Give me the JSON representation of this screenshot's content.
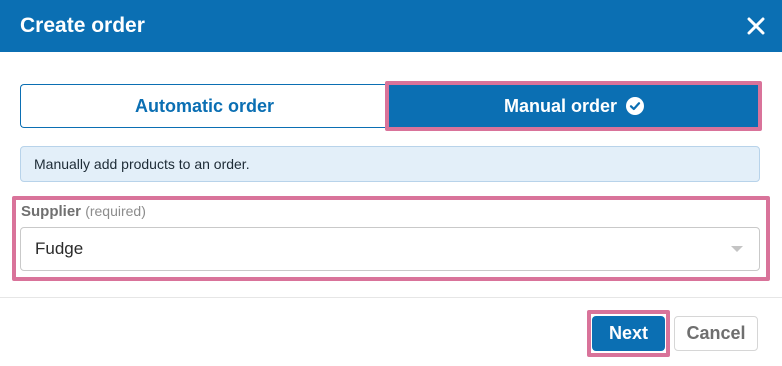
{
  "dialog": {
    "title": "Create order",
    "close_icon": "close-icon"
  },
  "order_type": {
    "options": [
      {
        "label": "Automatic order",
        "selected": false
      },
      {
        "label": "Manual order",
        "selected": true,
        "icon": "check-circle-icon"
      }
    ]
  },
  "info": {
    "text": "Manually add products to an order."
  },
  "supplier": {
    "label": "Supplier",
    "required_text": "(required)",
    "value": "Fudge",
    "caret_icon": "caret-down-icon"
  },
  "footer": {
    "next_label": "Next",
    "cancel_label": "Cancel"
  },
  "colors": {
    "primary": "#0b6fb3",
    "highlight": "#d9739a",
    "info_bg": "#e3eff9"
  }
}
